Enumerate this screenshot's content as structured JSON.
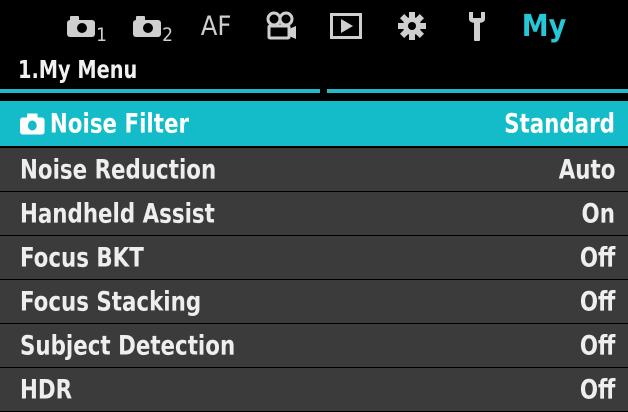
{
  "tabs": [
    {
      "id": "shooting-1",
      "icon": "camera-icon",
      "sub": "1"
    },
    {
      "id": "shooting-2",
      "icon": "camera-icon",
      "sub": "2"
    },
    {
      "id": "af",
      "label": "AF"
    },
    {
      "id": "video",
      "icon": "movie-camera-icon"
    },
    {
      "id": "playback",
      "icon": "play-icon"
    },
    {
      "id": "custom",
      "icon": "gear-icon"
    },
    {
      "id": "setup",
      "icon": "wrench-icon"
    },
    {
      "id": "my-menu",
      "label": "My",
      "active": true
    }
  ],
  "menu": {
    "title": "1.My Menu",
    "items": [
      {
        "icon": "camera-icon",
        "label": "Noise Filter",
        "value": "Standard",
        "selected": true
      },
      {
        "label": "Noise Reduction",
        "value": "Auto"
      },
      {
        "label": "Handheld Assist",
        "value": "On"
      },
      {
        "label": "Focus BKT",
        "value": "Off"
      },
      {
        "label": "Focus Stacking",
        "value": "Off"
      },
      {
        "label": "Subject Detection",
        "value": "Off"
      },
      {
        "label": "HDR",
        "value": "Off"
      }
    ]
  },
  "colors": {
    "accent": "#25c7d8",
    "selected_row": "#14bcca",
    "row_bg": "#3b3b3b",
    "background": "#000000"
  }
}
